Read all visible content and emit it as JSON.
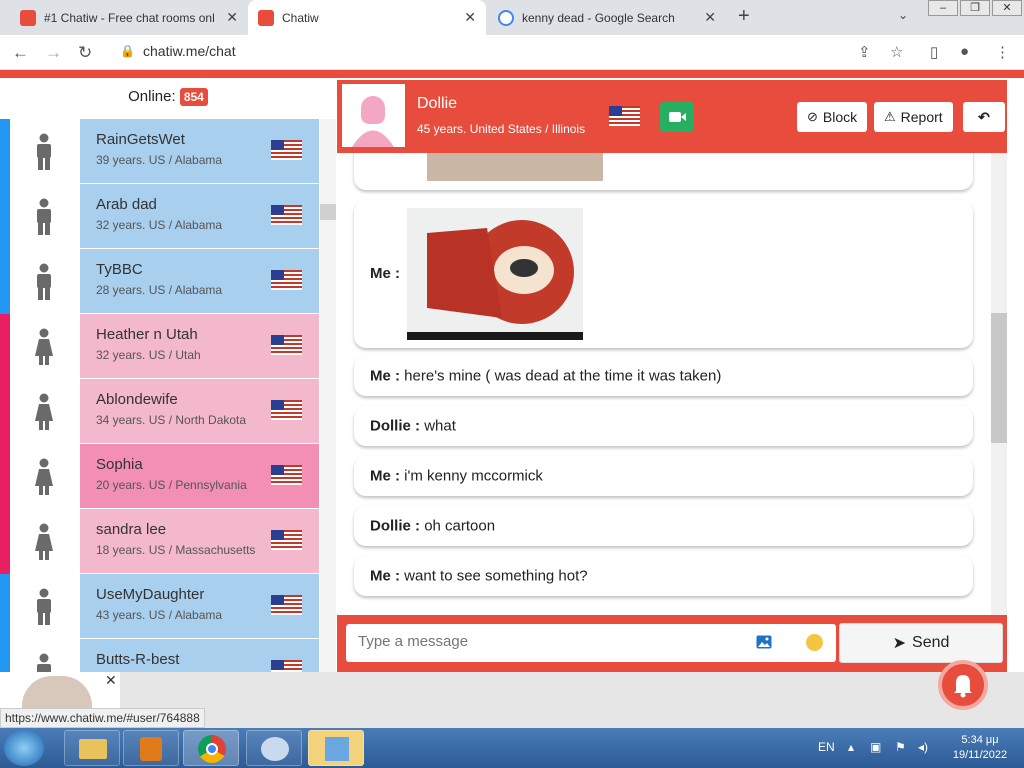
{
  "browser": {
    "tabs": [
      {
        "title": "#1 Chatiw - Free chat rooms onli",
        "active": false
      },
      {
        "title": "Chatiw",
        "active": true
      },
      {
        "title": "kenny dead - Google Search",
        "active": false
      }
    ],
    "url": "chatiw.me/chat",
    "status_url": "https://www.chatiw.me/#user/764888"
  },
  "online": {
    "label": "Online:",
    "count": "854"
  },
  "users": [
    {
      "name": "RainGetsWet",
      "info": "39 years. US / Alabama",
      "gender": "male"
    },
    {
      "name": "Arab dad",
      "info": "32 years. US / Alabama",
      "gender": "male"
    },
    {
      "name": "TyBBC",
      "info": "28 years. US / Alabama",
      "gender": "male"
    },
    {
      "name": "Heather n Utah",
      "info": "32 years. US / Utah",
      "gender": "female"
    },
    {
      "name": "Ablondewife",
      "info": "34 years. US / North Dakota",
      "gender": "female"
    },
    {
      "name": "Sophia",
      "info": "20 years. US / Pennsylvania",
      "gender": "female"
    },
    {
      "name": "sandra lee",
      "info": "18 years. US / Massachusetts",
      "gender": "female"
    },
    {
      "name": "UseMyDaughter",
      "info": "43 years. US / Alabama",
      "gender": "male"
    },
    {
      "name": "Butts-R-best",
      "info": "",
      "gender": "male"
    }
  ],
  "chat": {
    "partner_name": "Dollie",
    "partner_info": "45 years. United States / Illinois",
    "block_label": "Block",
    "report_label": "Report",
    "messages": [
      {
        "sender": "Me :",
        "text": "here's mine ( was dead at the time it was taken)"
      },
      {
        "sender": "Dollie :",
        "text": "what"
      },
      {
        "sender": "Me :",
        "text": "i'm kenny mccormick"
      },
      {
        "sender": "Dollie :",
        "text": "oh cartoon"
      },
      {
        "sender": "Me :",
        "text": "want to see something hot?"
      }
    ],
    "image_message_sender": "Me :",
    "input_placeholder": "Type a message",
    "send_label": "Send"
  },
  "taskbar": {
    "lang": "EN",
    "time": "5:34 μμ",
    "date": "19/11/2022"
  },
  "colors": {
    "accent": "#e74c3c",
    "male_card": "#a9cfee",
    "female_card": "#f4b8cc",
    "female_card_hover": "#f28fb2",
    "male_stripe": "#2196f3",
    "female_stripe": "#e91e63"
  }
}
